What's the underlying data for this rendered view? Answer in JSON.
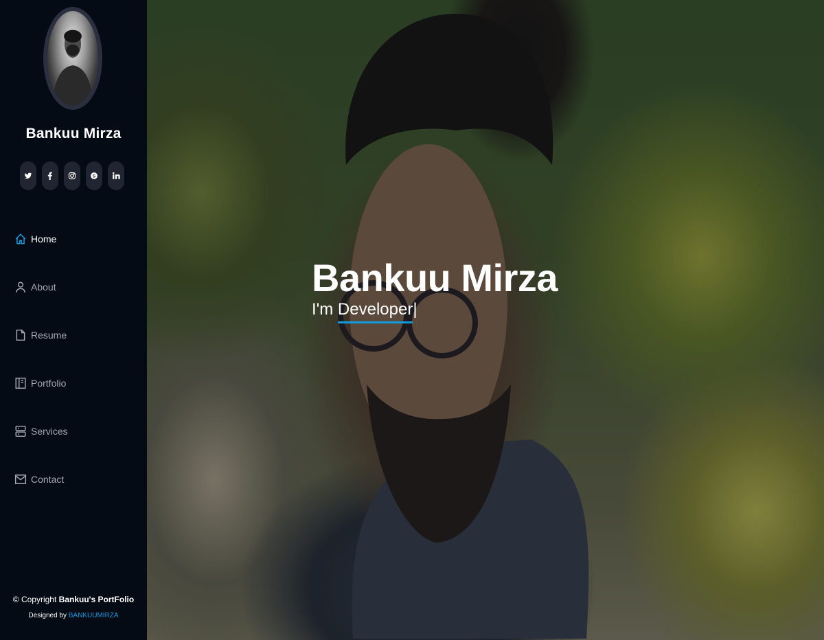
{
  "profile": {
    "name": "Bankuu Mirza"
  },
  "socials": [
    {
      "icon": "twitter-icon",
      "label": "twitter"
    },
    {
      "icon": "facebook-icon",
      "label": "facebook"
    },
    {
      "icon": "instagram-icon",
      "label": "instagram"
    },
    {
      "icon": "skype-icon",
      "label": "skype"
    },
    {
      "icon": "linkedin-icon",
      "label": "linkedin"
    }
  ],
  "nav": [
    {
      "label": "Home",
      "icon": "home-icon",
      "active": true
    },
    {
      "label": "About",
      "icon": "person-icon",
      "active": false
    },
    {
      "label": "Resume",
      "icon": "document-icon",
      "active": false
    },
    {
      "label": "Portfolio",
      "icon": "book-icon",
      "active": false
    },
    {
      "label": "Services",
      "icon": "server-icon",
      "active": false
    },
    {
      "label": "Contact",
      "icon": "envelope-icon",
      "active": false
    }
  ],
  "footer": {
    "copyright_prefix": "© Copyright",
    "copyright_name": "Bankuu's PortFolio",
    "designed_by": "Designed by",
    "designer": "BANKUUMIRZA"
  },
  "hero": {
    "title": "Bankuu Mirza",
    "subtitle_prefix": "I'm",
    "typed_text": "Developer",
    "cursor": "|"
  },
  "colors": {
    "accent": "#149ddd",
    "sidebar_bg": "#040b14",
    "social_bg": "#212431"
  }
}
